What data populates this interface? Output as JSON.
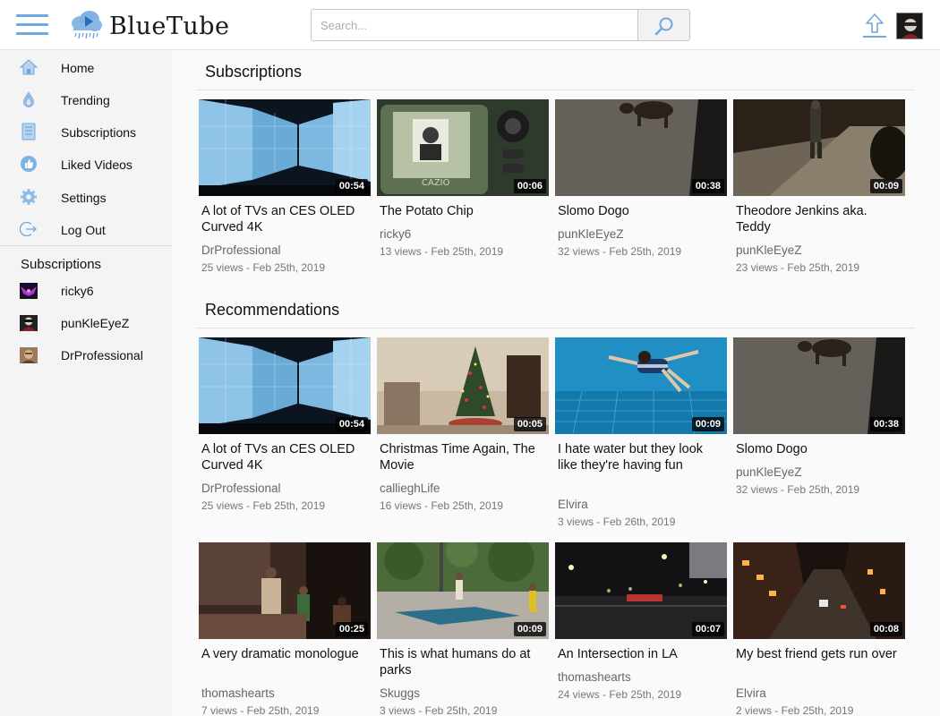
{
  "app": {
    "name": "BlueTube"
  },
  "colors": {
    "accent": "#6fa8dc",
    "sidebar_bg": "#f4f4f4",
    "header_bg": "#ffffff"
  },
  "header": {
    "search_placeholder": "Search...",
    "search_value": "",
    "search_icon": "search-icon",
    "upload_icon": "upload-icon",
    "menu_icon": "hamburger-icon"
  },
  "sidebar": {
    "nav": [
      {
        "label": "Home",
        "icon": "home-icon"
      },
      {
        "label": "Trending",
        "icon": "flame-icon"
      },
      {
        "label": "Subscriptions",
        "icon": "subscriptions-icon"
      },
      {
        "label": "Liked Videos",
        "icon": "thumbs-up-icon"
      },
      {
        "label": "Settings",
        "icon": "gear-icon"
      },
      {
        "label": "Log Out",
        "icon": "logout-icon"
      }
    ],
    "subscriptions_heading": "Subscriptions",
    "subscriptions": [
      {
        "name": "ricky6"
      },
      {
        "name": "punKleEyeZ"
      },
      {
        "name": "DrProfessional"
      }
    ]
  },
  "sections": [
    {
      "title": "Subscriptions",
      "videos": [
        {
          "title": "A lot of TVs an CES OLED Curved 4K",
          "channel": "DrProfessional",
          "meta": "25 views - Feb 25th, 2019",
          "duration": "00:54"
        },
        {
          "title": "The Potato Chip",
          "channel": "ricky6",
          "meta": "13 views - Feb 25th, 2019",
          "duration": "00:06"
        },
        {
          "title": "Slomo Dogo",
          "channel": "punKleEyeZ",
          "meta": "32 views - Feb 25th, 2019",
          "duration": "00:38"
        },
        {
          "title": "Theodore Jenkins aka. Teddy",
          "channel": "punKleEyeZ",
          "meta": "23 views - Feb 25th, 2019",
          "duration": "00:09"
        }
      ]
    },
    {
      "title": "Recommendations",
      "videos": [
        {
          "title": "A lot of TVs an CES OLED Curved 4K",
          "channel": "DrProfessional",
          "meta": "25 views - Feb 25th, 2019",
          "duration": "00:54"
        },
        {
          "title": "Christmas Time Again, The Movie",
          "channel": "callieghLife",
          "meta": "16 views - Feb 25th, 2019",
          "duration": "00:05"
        },
        {
          "title": "I hate water but they look like they're having fun",
          "channel": "Elvira",
          "meta": "3 views - Feb 26th, 2019",
          "duration": "00:09"
        },
        {
          "title": "Slomo Dogo",
          "channel": "punKleEyeZ",
          "meta": "32 views - Feb 25th, 2019",
          "duration": "00:38"
        },
        {
          "title": "A very dramatic monologue",
          "channel": "thomashearts",
          "meta": "7 views - Feb 25th, 2019",
          "duration": "00:25"
        },
        {
          "title": "This is what humans do at parks",
          "channel": "Skuggs",
          "meta": "3 views - Feb 25th, 2019",
          "duration": "00:09"
        },
        {
          "title": "An Intersection in LA",
          "channel": "thomashearts",
          "meta": "24 views - Feb 25th, 2019",
          "duration": "00:07"
        },
        {
          "title": "My best friend gets run over",
          "channel": "Elvira",
          "meta": "2 views - Feb 25th, 2019",
          "duration": "00:08"
        }
      ]
    }
  ]
}
